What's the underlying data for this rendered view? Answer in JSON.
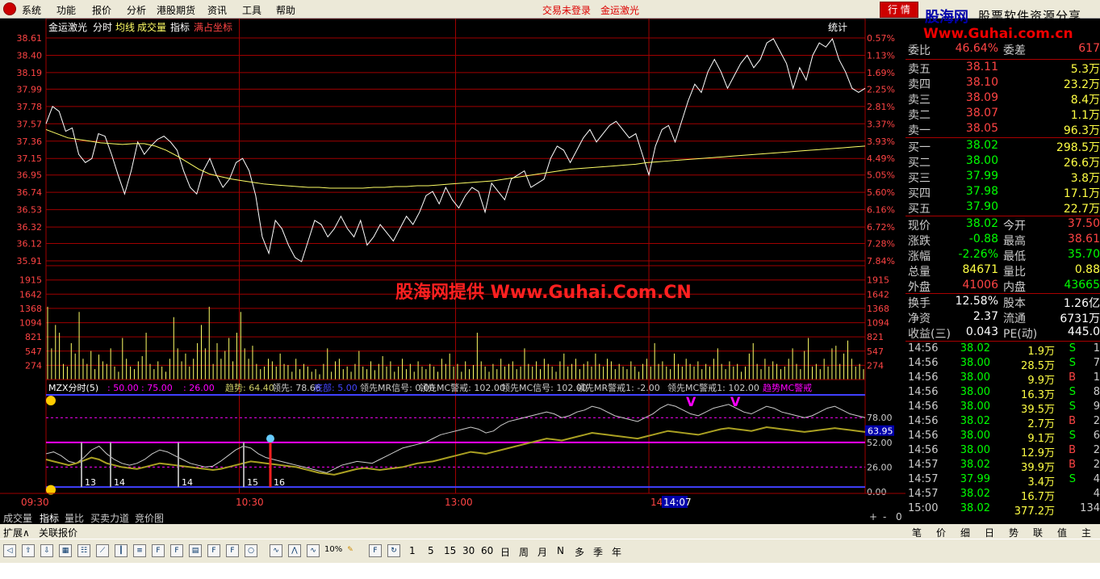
{
  "menu": {
    "items": [
      "系统",
      "功能",
      "报价",
      "分析",
      "港股期货",
      "资讯",
      "工具",
      "帮助"
    ],
    "status_login": "交易未登录",
    "status_stock": "金运激光",
    "hq_button": "行 情",
    "brand_name": "股海网",
    "brand_tagline": "股票软件资源分享",
    "brand_url": "Www.Guhai.com.cn"
  },
  "chart_header": {
    "stock_name": "金运激光",
    "mode_label": "分时",
    "avg_label": "均线",
    "vol_label": "成交量",
    "ind_label": "指标",
    "coord_label": "满占坐标",
    "stats_label": "统计"
  },
  "watermark": "股海网提供 Www.Guhai.Com.CN",
  "colors": {
    "price": "#ffffff",
    "avg": "#ffff66",
    "grid": "#a00000",
    "axis_left": "#ff4444",
    "axis_right": "#ff4444",
    "volume": "#ffff66",
    "magenta": "#ff00ff",
    "blue": "#4040ff"
  },
  "chart_data": [
    {
      "type": "line",
      "name_label": "price_chart",
      "y_ticks": [
        "38.61",
        "38.40",
        "38.19",
        "37.99",
        "37.78",
        "37.57",
        "37.36",
        "37.15",
        "36.95",
        "36.74",
        "36.53",
        "36.32",
        "36.12",
        "35.91"
      ],
      "y_ticks_right": [
        "0.57%",
        "1.13%",
        "1.69%",
        "2.25%",
        "2.81%",
        "3.37%",
        "3.93%",
        "4.49%",
        "5.05%",
        "5.60%",
        "6.16%",
        "6.72%",
        "7.28%",
        "7.84%"
      ],
      "ylim": [
        35.91,
        38.61
      ],
      "x_labels": [
        "09:30",
        "10:30",
        "13:00",
        "14:00"
      ],
      "cursor_time": "14:07",
      "series": [
        {
          "values": [
            37.57,
            37.78,
            37.72,
            37.48,
            37.52,
            37.2,
            37.1,
            37.15,
            37.45,
            37.42,
            37.2,
            36.95,
            36.72,
            37.0,
            37.35,
            37.2,
            37.3,
            37.38,
            37.42,
            37.35,
            37.25,
            37.0,
            36.8,
            36.72,
            37.0,
            37.15,
            36.95,
            36.8,
            36.9,
            37.1,
            37.15,
            37.0,
            36.7,
            36.2,
            36.0,
            36.4,
            36.3,
            36.1,
            35.95,
            35.9,
            36.15,
            36.4,
            36.35,
            36.2,
            36.3,
            36.45,
            36.3,
            36.2,
            36.4,
            36.1,
            36.2,
            36.35,
            36.25,
            36.15,
            36.3,
            36.45,
            36.35,
            36.5,
            36.7,
            36.75,
            36.6,
            36.8,
            36.65,
            36.55,
            36.7,
            36.8,
            36.75,
            36.5,
            36.85,
            36.75,
            36.65,
            36.9,
            36.95,
            37.0,
            36.8,
            36.85,
            36.9,
            37.15,
            37.3,
            37.25,
            37.1,
            37.25,
            37.4,
            37.5,
            37.35,
            37.45,
            37.55,
            37.6,
            37.5,
            37.4,
            37.45,
            37.2,
            36.95,
            37.3,
            37.5,
            37.55,
            37.35,
            37.6,
            37.85,
            38.05,
            37.95,
            38.2,
            38.35,
            38.2,
            38.0,
            38.15,
            38.3,
            38.4,
            38.25,
            38.35,
            38.55,
            38.6,
            38.45,
            38.3,
            38.0,
            38.25,
            38.1,
            38.4,
            38.55,
            38.5,
            38.6,
            38.35,
            38.2,
            38.0,
            37.95,
            38.0
          ],
          "name_hidden": true
        },
        {
          "values": [
            37.5,
            37.45,
            37.4,
            37.38,
            37.36,
            37.34,
            37.33,
            37.32,
            37.33,
            37.33,
            37.3,
            37.25,
            37.18,
            37.1,
            37.02,
            36.96,
            36.93,
            36.9,
            36.88,
            36.86,
            36.84,
            36.83,
            36.82,
            36.81,
            36.8,
            36.8,
            36.79,
            36.79,
            36.79,
            36.79,
            36.8,
            36.8,
            36.81,
            36.81,
            36.82,
            36.82,
            36.83,
            36.84,
            36.85,
            36.86,
            36.87,
            36.88,
            36.9,
            36.92,
            36.94,
            36.96,
            36.98,
            37.0,
            37.02,
            37.03,
            37.04,
            37.05,
            37.06,
            37.07,
            37.08,
            37.1,
            37.11,
            37.12,
            37.13,
            37.14,
            37.15,
            37.16,
            37.17,
            37.18,
            37.19,
            37.2,
            37.21,
            37.22,
            37.23,
            37.24,
            37.25,
            37.26,
            37.27,
            37.28,
            37.29,
            37.3
          ],
          "name_hidden": true
        }
      ]
    },
    {
      "type": "bar",
      "name_label": "volume_chart",
      "y_ticks": [
        "1915",
        "1642",
        "1368",
        "1094",
        "821",
        "547",
        "274"
      ],
      "ylim": [
        0,
        2190
      ],
      "values": [
        1400,
        600,
        1050,
        900,
        300,
        250,
        700,
        500,
        1300,
        400,
        300,
        550,
        200,
        480,
        350,
        300,
        600,
        250,
        150,
        800,
        400,
        250,
        200,
        350,
        450,
        900,
        300,
        200,
        350,
        250,
        150,
        400,
        1200,
        600,
        350,
        500,
        250,
        400,
        700,
        1050,
        600,
        1400,
        300,
        700,
        400,
        550,
        800,
        350,
        900,
        1300,
        600,
        400,
        650,
        300,
        200,
        250,
        400,
        350,
        250,
        500,
        300,
        280,
        150,
        400,
        200,
        300,
        250,
        150,
        200,
        100,
        300,
        600,
        150,
        350,
        400,
        200,
        250,
        150,
        300,
        550,
        250,
        200,
        350,
        180,
        300,
        450,
        250,
        350,
        150,
        250,
        400,
        200,
        300,
        150,
        350,
        250,
        200,
        300,
        250,
        150,
        400,
        300,
        500,
        250,
        300,
        150,
        350,
        200,
        280,
        900,
        350,
        250,
        150,
        300,
        200,
        400,
        250,
        300,
        350,
        200,
        250,
        600,
        300,
        250,
        350,
        200,
        400,
        300,
        250,
        150,
        350,
        500,
        250,
        300,
        400,
        200,
        300,
        350,
        250,
        500,
        300,
        250,
        400,
        350,
        200,
        300,
        250,
        200,
        350,
        250,
        150,
        300,
        400,
        250,
        700,
        300,
        350,
        250,
        200,
        500,
        300,
        250,
        400,
        300,
        250,
        350,
        200,
        300,
        250,
        400,
        600,
        300,
        200,
        350,
        250,
        300,
        150,
        250,
        500,
        700,
        300,
        200,
        400,
        250,
        350,
        300,
        200,
        250,
        400,
        600,
        300,
        200,
        550,
        800,
        250,
        300,
        200,
        400,
        250,
        600,
        650,
        300,
        500,
        750,
        400,
        250,
        300,
        200
      ]
    },
    {
      "type": "line",
      "name_label": "indicator_chart",
      "header": {
        "name": "MZX分时(5)",
        "p1": ": 50.00",
        "p2": ": 75.00",
        "p3": ": 26.00",
        "trend": "趋势: 64.40",
        "lead": "领先: 78.66",
        "bottom": "底部: 5.00",
        "mr": "领先MR信号: 0.00",
        "mcw": "领先MC警戒: 102.00",
        "mcs": "领先MC信号: 102.00",
        "mrw": "领先MR警戒1: -2.00",
        "mcw1": "领先MC警戒1: 102.00",
        "trend_mc": "趋势MC警戒"
      },
      "y_ticks": [
        "78.00",
        "52.00",
        "26.00",
        "0.00"
      ],
      "current_value": "63.95",
      "ylim": [
        0,
        102
      ],
      "signal_labels": [
        "13",
        "14",
        "14",
        "15",
        "16"
      ],
      "series": [
        {
          "values": [
            34,
            32,
            30,
            28,
            30,
            33,
            36,
            34,
            30,
            28,
            26,
            25,
            24,
            26,
            28,
            30,
            29,
            28,
            27,
            26,
            25,
            24,
            23,
            24,
            26,
            28,
            30,
            32,
            31,
            30,
            29,
            28,
            27,
            26,
            24,
            22,
            20,
            19,
            18,
            20,
            22,
            24,
            25,
            24,
            23,
            24,
            25,
            26,
            28,
            30,
            31,
            32,
            34,
            36,
            38,
            40,
            42,
            41,
            40,
            42,
            44,
            46,
            48,
            50,
            52,
            54,
            56,
            55,
            54,
            56,
            58,
            60,
            62,
            61,
            60,
            59,
            58,
            57,
            56,
            58,
            60,
            62,
            64,
            63,
            62,
            61,
            60,
            62,
            64,
            66,
            67,
            66,
            65,
            64,
            66,
            68,
            67,
            66,
            65,
            64,
            63,
            64,
            65,
            66,
            67,
            66,
            65,
            64,
            63
          ]
        },
        {
          "values": [
            40,
            42,
            38,
            32,
            30,
            36,
            44,
            48,
            40,
            34,
            30,
            28,
            30,
            34,
            40,
            44,
            42,
            38,
            34,
            30,
            28,
            26,
            27,
            32,
            38,
            44,
            48,
            46,
            40,
            36,
            34,
            32,
            30,
            28,
            26,
            24,
            22,
            20,
            24,
            28,
            30,
            32,
            31,
            30,
            34,
            38,
            42,
            46,
            48,
            50,
            52,
            56,
            60,
            62,
            64,
            66,
            68,
            66,
            62,
            64,
            70,
            74,
            76,
            78,
            80,
            82,
            84,
            82,
            78,
            80,
            84,
            86,
            90,
            88,
            84,
            80,
            78,
            76,
            74,
            78,
            82,
            88,
            92,
            90,
            86,
            82,
            80,
            84,
            88,
            90,
            92,
            88,
            84,
            82,
            86,
            90,
            88,
            84,
            82,
            80,
            78,
            80,
            84,
            88,
            90,
            86,
            82,
            80,
            78
          ]
        }
      ]
    }
  ],
  "tabs": [
    "成交量",
    "指标",
    "量比",
    "买卖力道",
    "竞价图"
  ],
  "tab_controls": [
    "+",
    "-",
    "0"
  ],
  "ext_row": [
    "扩展∧",
    "关联报价"
  ],
  "right_panel": {
    "wei": {
      "label": "委比",
      "value": "46.64%",
      "label2": "委差",
      "value2": "617"
    },
    "asks": [
      {
        "label": "卖五",
        "price": "38.11",
        "vol": "5.3万"
      },
      {
        "label": "卖四",
        "price": "38.10",
        "vol": "23.2万"
      },
      {
        "label": "卖三",
        "price": "38.09",
        "vol": "8.4万"
      },
      {
        "label": "卖二",
        "price": "38.07",
        "vol": "1.1万"
      },
      {
        "label": "卖一",
        "price": "38.05",
        "vol": "96.3万"
      }
    ],
    "bids": [
      {
        "label": "买一",
        "price": "38.02",
        "vol": "298.5万"
      },
      {
        "label": "买二",
        "price": "38.00",
        "vol": "26.6万"
      },
      {
        "label": "买三",
        "price": "37.99",
        "vol": "3.8万"
      },
      {
        "label": "买四",
        "price": "37.98",
        "vol": "17.1万"
      },
      {
        "label": "买五",
        "price": "37.90",
        "vol": "22.7万"
      }
    ],
    "stats1": [
      {
        "l1": "现价",
        "v1": "38.02",
        "l2": "今开",
        "v2": "37.50"
      },
      {
        "l1": "涨跌",
        "v1": "-0.88",
        "l2": "最高",
        "v2": "38.61"
      },
      {
        "l1": "涨幅",
        "v1": "-2.26%",
        "l2": "最低",
        "v2": "35.70"
      },
      {
        "l1": "总量",
        "v1": "84671",
        "l2": "量比",
        "v2": "0.88"
      },
      {
        "l1": "外盘",
        "v1": "41006",
        "l2": "内盘",
        "v2": "43665"
      }
    ],
    "stats2": [
      {
        "l1": "换手",
        "v1": "12.58%",
        "l2": "股本",
        "v2": "1.26亿"
      },
      {
        "l1": "净资",
        "v1": "2.37",
        "l2": "流通",
        "v2": "6731万"
      },
      {
        "l1": "收益(三)",
        "v1": "0.043",
        "l2": "PE(动)",
        "v2": "445.0"
      }
    ],
    "ticks": [
      {
        "t": "14:56",
        "p": "38.02",
        "v": "1.9万",
        "s": "S",
        "n": "1"
      },
      {
        "t": "14:56",
        "p": "38.00",
        "v": "28.5万",
        "s": "S",
        "n": "7"
      },
      {
        "t": "14:56",
        "p": "38.00",
        "v": "9.9万",
        "s": "B",
        "n": "1"
      },
      {
        "t": "14:56",
        "p": "38.00",
        "v": "16.3万",
        "s": "S",
        "n": "8"
      },
      {
        "t": "14:56",
        "p": "38.00",
        "v": "39.5万",
        "s": "S",
        "n": "9"
      },
      {
        "t": "14:56",
        "p": "38.02",
        "v": "2.7万",
        "s": "B",
        "n": "2"
      },
      {
        "t": "14:56",
        "p": "38.00",
        "v": "9.1万",
        "s": "S",
        "n": "6"
      },
      {
        "t": "14:56",
        "p": "38.00",
        "v": "12.9万",
        "s": "B",
        "n": "2"
      },
      {
        "t": "14:57",
        "p": "38.02",
        "v": "39.9万",
        "s": "B",
        "n": "2"
      },
      {
        "t": "14:57",
        "p": "37.99",
        "v": "3.4万",
        "s": "S",
        "n": "4"
      },
      {
        "t": "14:57",
        "p": "38.02",
        "v": "16.7万",
        "s": "",
        "n": "4"
      },
      {
        "t": "15:00",
        "p": "38.02",
        "v": "377.2万",
        "s": "",
        "n": "134"
      }
    ]
  },
  "right_tabs": [
    "笔",
    "价",
    "细",
    "日",
    "势",
    "联",
    "值",
    "主"
  ],
  "toolbar_periods": [
    "1",
    "5",
    "15",
    "30",
    "60",
    "日",
    "周",
    "月",
    "N",
    "多",
    "季",
    "年"
  ],
  "toolbar_pct": "10%",
  "toolbar_icons": [
    "back-icon",
    "up-icon",
    "down-icon",
    "grid-icon",
    "table-icon",
    "line-chart-icon",
    "candle-icon",
    "f10-icon",
    "fa-icon",
    "list-icon",
    "f2-icon",
    "f6-icon",
    "circle-icon",
    "wave-icon",
    "mountain-icon",
    "bars-icon",
    "pct-icon",
    "pencil-icon",
    "f5-icon",
    "refresh-icon"
  ]
}
